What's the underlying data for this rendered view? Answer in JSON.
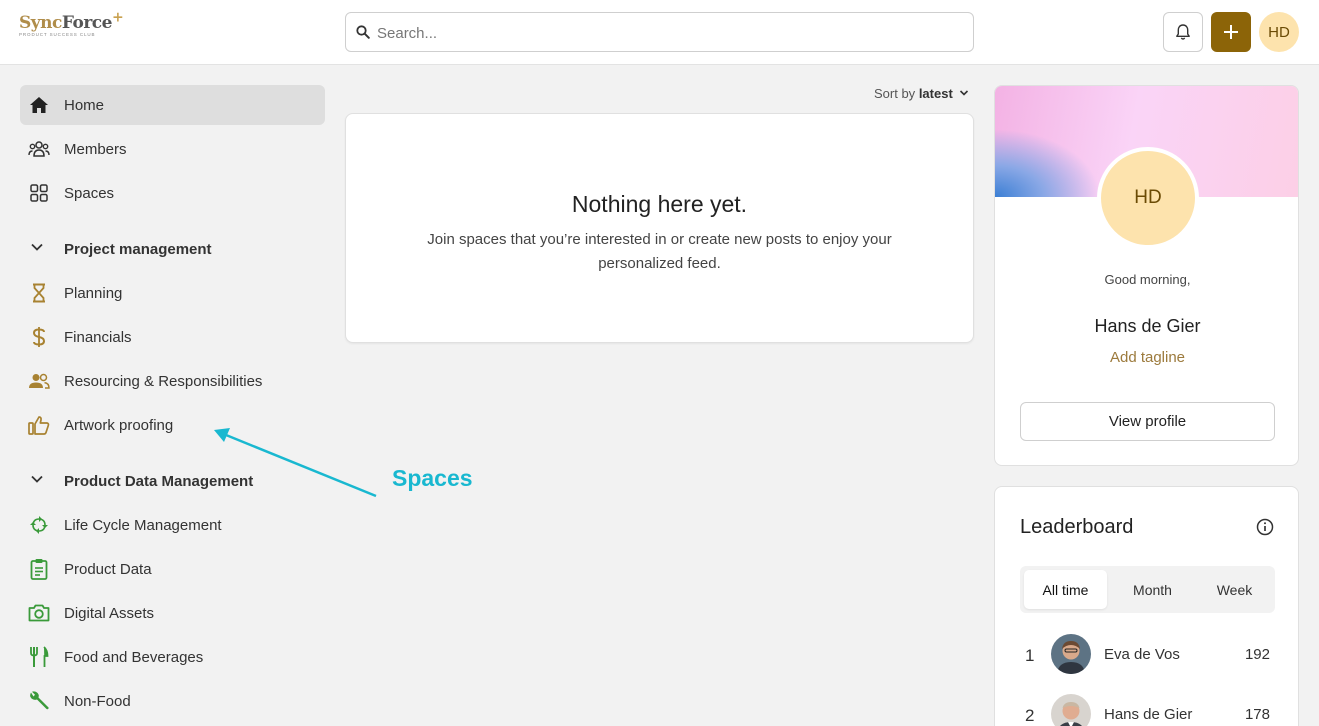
{
  "header": {
    "logo": {
      "brand_a": "Sync",
      "brand_b": "Force",
      "plus": "+",
      "tagline": "PRODUCT SUCCESS CLUB"
    },
    "search": {
      "placeholder": "Search..."
    },
    "user_initials": "HD",
    "accent_color": "#8c6408"
  },
  "sidebar": {
    "top_items": [
      {
        "label": "Home",
        "icon": "home-icon",
        "active": true
      },
      {
        "label": "Members",
        "icon": "members-icon"
      },
      {
        "label": "Spaces",
        "icon": "grid-icon"
      }
    ],
    "sections": [
      {
        "title": "Project management",
        "items": [
          {
            "label": "Planning",
            "icon": "hourglass-icon"
          },
          {
            "label": "Financials",
            "icon": "dollar-icon"
          },
          {
            "label": "Resourcing & Responsibilities",
            "icon": "people-icon"
          },
          {
            "label": "Artwork proofing",
            "icon": "thumbs-up-icon"
          }
        ]
      },
      {
        "title": "Product Data Management",
        "items": [
          {
            "label": "Life Cycle Management",
            "icon": "cycle-icon"
          },
          {
            "label": "Product Data",
            "icon": "clipboard-icon"
          },
          {
            "label": "Digital Assets",
            "icon": "camera-icon"
          },
          {
            "label": "Food and Beverages",
            "icon": "fork-knife-icon"
          },
          {
            "label": "Non-Food",
            "icon": "wrench-icon"
          }
        ]
      }
    ]
  },
  "feed": {
    "sort_prefix": "Sort by",
    "sort_value": "latest",
    "empty_title": "Nothing here yet.",
    "empty_text": "Join spaces that you’re interested in or create new posts to enjoy your personalized feed."
  },
  "profile": {
    "initials": "HD",
    "greeting": "Good morning,",
    "name": "Hans de Gier",
    "tagline_link": "Add tagline",
    "view_button": "View profile"
  },
  "leaderboard": {
    "title": "Leaderboard",
    "tabs": [
      {
        "label": "All time",
        "active": true
      },
      {
        "label": "Month"
      },
      {
        "label": "Week"
      }
    ],
    "rows": [
      {
        "rank": "1",
        "name": "Eva de Vos",
        "points": "192"
      },
      {
        "rank": "2",
        "name": "Hans de Gier",
        "points": "178"
      }
    ]
  },
  "annotation": {
    "label": "Spaces",
    "color": "#19b8d0"
  }
}
